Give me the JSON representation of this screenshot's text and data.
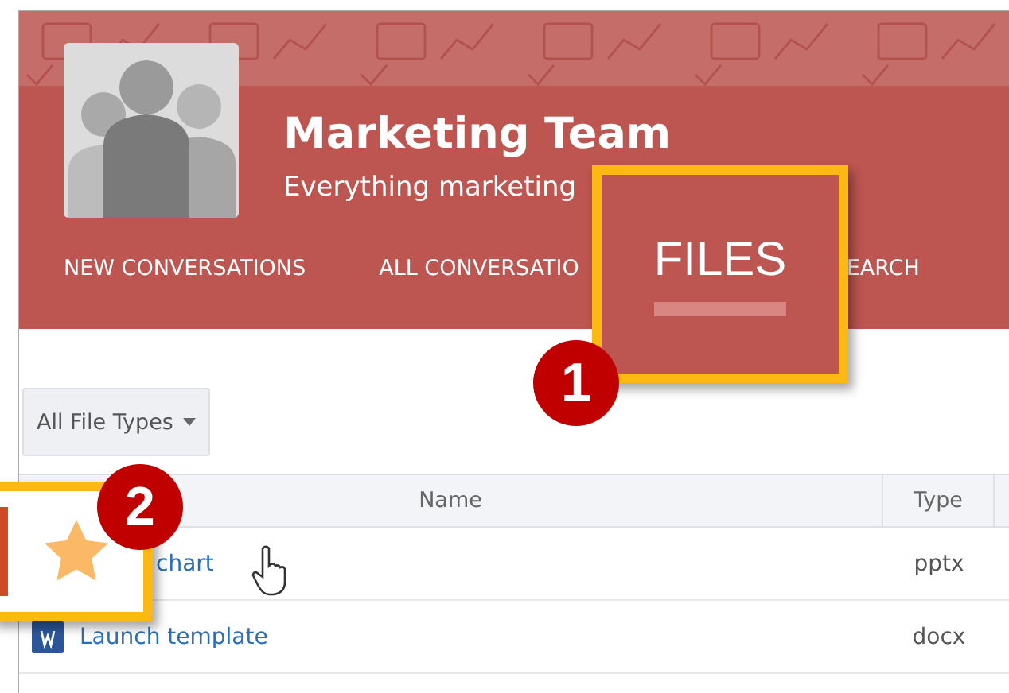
{
  "group": {
    "title": "Marketing Team",
    "subtitle": "Everything marketing"
  },
  "nav": [
    {
      "label": "NEW CONVERSATIONS",
      "selected": false
    },
    {
      "label": "ALL CONVERSATIO",
      "selected": false
    },
    {
      "label": "EARCH",
      "selected": false
    }
  ],
  "filter": {
    "label": "All File Types"
  },
  "table": {
    "columns": [
      "Name",
      "Type"
    ],
    "rows": [
      {
        "name": "chart",
        "type": "pptx",
        "kind": "plain"
      },
      {
        "name": "Launch template",
        "type": "docx",
        "kind": "word"
      }
    ]
  },
  "callouts": [
    {
      "number": "1",
      "tab": {
        "label": "FILES",
        "selected": true
      }
    },
    {
      "number": "2"
    }
  ]
}
